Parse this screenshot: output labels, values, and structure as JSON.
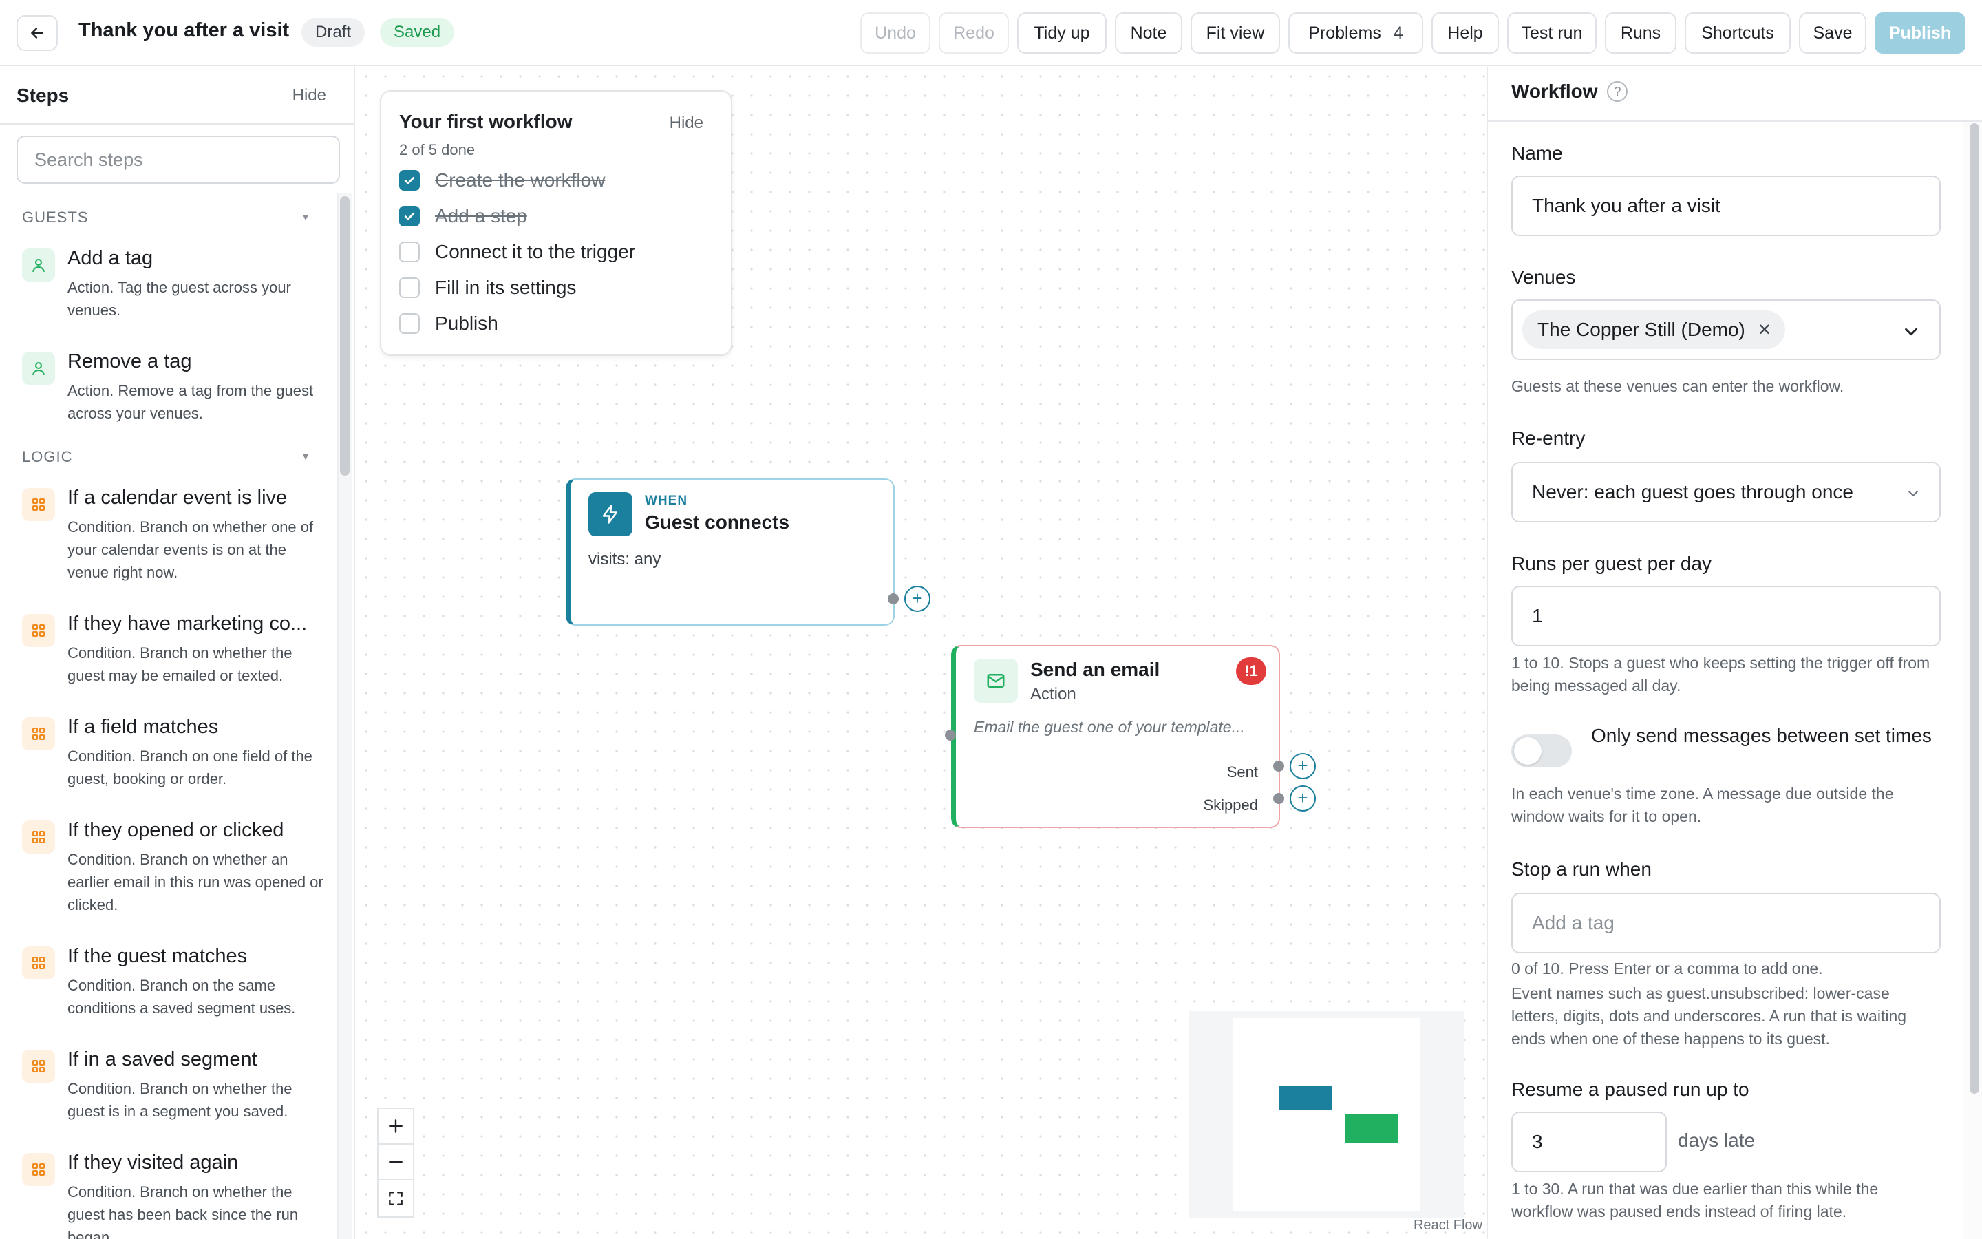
{
  "header": {
    "title": "Thank you after a visit",
    "status_draft": "Draft",
    "status_saved": "Saved",
    "buttons": {
      "undo": "Undo",
      "redo": "Redo",
      "tidy_up": "Tidy up",
      "note": "Note",
      "fit_view": "Fit view",
      "problems": "Problems",
      "problems_count": "4",
      "help": "Help",
      "test_run": "Test run",
      "runs": "Runs",
      "shortcuts": "Shortcuts",
      "save": "Save",
      "publish": "Publish"
    }
  },
  "sidebar": {
    "title": "Steps",
    "hide": "Hide",
    "search_placeholder": "Search steps",
    "sections": [
      {
        "name": "GUESTS"
      },
      {
        "name": "LOGIC"
      }
    ],
    "steps": [
      {
        "title": "Add a tag",
        "desc": "Action. Tag the guest across your venues."
      },
      {
        "title": "Remove a tag",
        "desc": "Action. Remove a tag from the guest across your venues."
      },
      {
        "title": "If a calendar event is live",
        "desc": "Condition. Branch on whether one of your calendar events is on at the venue right now."
      },
      {
        "title": "If they have marketing co...",
        "desc": "Condition. Branch on whether the guest may be emailed or texted."
      },
      {
        "title": "If a field matches",
        "desc": "Condition. Branch on one field of the guest, booking or order."
      },
      {
        "title": "If they opened or clicked",
        "desc": "Condition. Branch on whether an earlier email in this run was opened or clicked."
      },
      {
        "title": "If the guest matches",
        "desc": "Condition. Branch on the same conditions a saved segment uses."
      },
      {
        "title": "If in a saved segment",
        "desc": "Condition. Branch on whether the guest is in a segment you saved."
      },
      {
        "title": "If they visited again",
        "desc": "Condition. Branch on whether the guest has been back since the run began."
      }
    ]
  },
  "checklist": {
    "title": "Your first workflow",
    "progress": "2 of 5 done",
    "hide": "Hide",
    "items": [
      {
        "label": "Create the workflow",
        "done": true
      },
      {
        "label": "Add a step",
        "done": true
      },
      {
        "label": "Connect it to the trigger",
        "done": false
      },
      {
        "label": "Fill in its settings",
        "done": false
      },
      {
        "label": "Publish",
        "done": false
      }
    ]
  },
  "trigger_node": {
    "kicker": "WHEN",
    "title": "Guest connects",
    "meta": "visits: any"
  },
  "action_node": {
    "title": "Send an email",
    "subtitle": "Action",
    "error_badge": "!1",
    "desc": "Email the guest one of your template...",
    "outputs": [
      "Sent",
      "Skipped"
    ]
  },
  "canvas": {
    "attribution": "React Flow"
  },
  "panel": {
    "title": "Workflow",
    "help_icon": "?",
    "name_label": "Name",
    "name_value": "Thank you after a visit",
    "venues_label": "Venues",
    "venue_chip": "The Copper Still (Demo)",
    "venues_help": "Guests at these venues can enter the workflow.",
    "reentry_label": "Re-entry",
    "reentry_value": "Never: each guest goes through once",
    "runs_label": "Runs per guest per day",
    "runs_value": "1",
    "runs_help": "1 to 10. Stops a guest who keeps setting the trigger off from being messaged all day.",
    "quiet_label": "Only send messages between set times",
    "quiet_help": "In each venue's time zone. A message due outside the window waits for it to open.",
    "stop_label": "Stop a run when",
    "stop_placeholder": "Add a tag",
    "stop_count": "0 of 10. Press Enter or a comma to add one.",
    "stop_help": "Event names such as guest.unsubscribed: lower-case letters, digits, dots and underscores. A run that is waiting ends when one of these happens to its guest.",
    "resume_label": "Resume a paused run up to",
    "resume_value": "3",
    "resume_unit": "days late",
    "resume_help": "1 to 30. A run that was due earlier than this while the workflow was paused ends instead of firing late."
  },
  "colors": {
    "accent": "#1b7f9e",
    "success": "#21b05f",
    "error": "#e23b3b",
    "publish_disabled": "#9ccfdf"
  },
  "icons": {
    "back": "arrow-left-icon",
    "guest_step": "person-icon",
    "logic_step": "grid-icon",
    "trigger": "lightning-icon",
    "email": "mail-icon"
  }
}
